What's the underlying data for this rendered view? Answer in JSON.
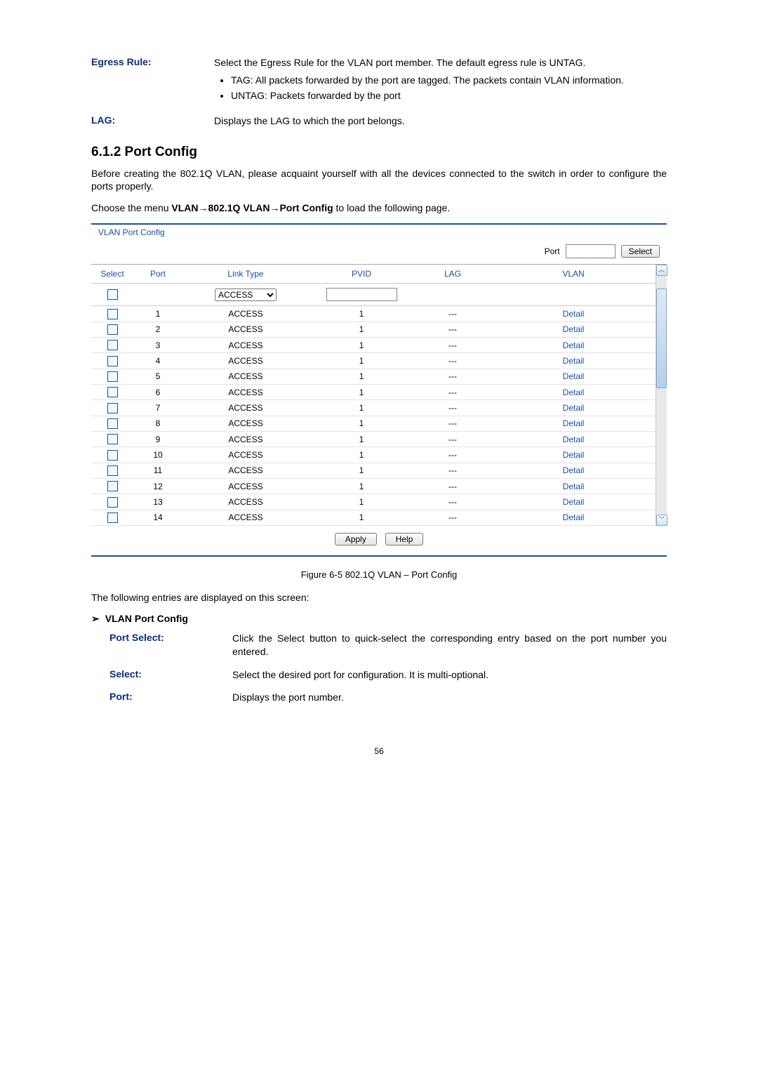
{
  "defs_top": [
    {
      "label": "Egress Rule:",
      "body": "Select the Egress Rule for the VLAN port member. The default egress rule is UNTAG.",
      "bullets": [
        "TAG: All packets forwarded by the port are tagged. The packets contain VLAN information.",
        "UNTAG: Packets forwarded by the port"
      ]
    },
    {
      "label": "LAG:",
      "body": "Displays the LAG to which the port belongs.",
      "bullets": []
    }
  ],
  "section_heading": "6.1.2 Port Config",
  "intro_para": "Before creating the 802.1Q VLAN, please acquaint yourself with all the devices connected to the switch in order to configure the ports properly.",
  "menu_line_prefix": "Choose the menu ",
  "menu_line_bold": "VLAN→802.1Q VLAN→Port Config",
  "menu_line_suffix": " to load the following page.",
  "panel": {
    "title": "VLAN Port Config",
    "port_label": "Port",
    "select_btn": "Select",
    "headers": {
      "select": "Select",
      "port": "Port",
      "link_type": "Link Type",
      "pvid": "PVID",
      "lag": "LAG",
      "vlan": "VLAN"
    },
    "link_type_option": "ACCESS",
    "rows": [
      {
        "port": "1",
        "link_type": "ACCESS",
        "pvid": "1",
        "lag": "---",
        "vlan": "Detail"
      },
      {
        "port": "2",
        "link_type": "ACCESS",
        "pvid": "1",
        "lag": "---",
        "vlan": "Detail"
      },
      {
        "port": "3",
        "link_type": "ACCESS",
        "pvid": "1",
        "lag": "---",
        "vlan": "Detail"
      },
      {
        "port": "4",
        "link_type": "ACCESS",
        "pvid": "1",
        "lag": "---",
        "vlan": "Detail"
      },
      {
        "port": "5",
        "link_type": "ACCESS",
        "pvid": "1",
        "lag": "---",
        "vlan": "Detail"
      },
      {
        "port": "6",
        "link_type": "ACCESS",
        "pvid": "1",
        "lag": "---",
        "vlan": "Detail"
      },
      {
        "port": "7",
        "link_type": "ACCESS",
        "pvid": "1",
        "lag": "---",
        "vlan": "Detail"
      },
      {
        "port": "8",
        "link_type": "ACCESS",
        "pvid": "1",
        "lag": "---",
        "vlan": "Detail"
      },
      {
        "port": "9",
        "link_type": "ACCESS",
        "pvid": "1",
        "lag": "---",
        "vlan": "Detail"
      },
      {
        "port": "10",
        "link_type": "ACCESS",
        "pvid": "1",
        "lag": "---",
        "vlan": "Detail"
      },
      {
        "port": "11",
        "link_type": "ACCESS",
        "pvid": "1",
        "lag": "---",
        "vlan": "Detail"
      },
      {
        "port": "12",
        "link_type": "ACCESS",
        "pvid": "1",
        "lag": "---",
        "vlan": "Detail"
      },
      {
        "port": "13",
        "link_type": "ACCESS",
        "pvid": "1",
        "lag": "---",
        "vlan": "Detail"
      },
      {
        "port": "14",
        "link_type": "ACCESS",
        "pvid": "1",
        "lag": "---",
        "vlan": "Detail"
      }
    ],
    "apply": "Apply",
    "help": "Help"
  },
  "figure_caption": "Figure 6-5 802.1Q VLAN – Port Config",
  "entries_line": "The following entries are displayed on this screen:",
  "sub_heading": "VLAN Port Config",
  "defs_bottom": [
    {
      "label": "Port Select:",
      "body": "Click the Select button to quick-select the corresponding entry based on the port number you entered."
    },
    {
      "label": "Select:",
      "body": "Select the desired port for configuration. It is multi-optional."
    },
    {
      "label": "Port:",
      "body": "Displays the port number."
    }
  ],
  "page_number": "56"
}
